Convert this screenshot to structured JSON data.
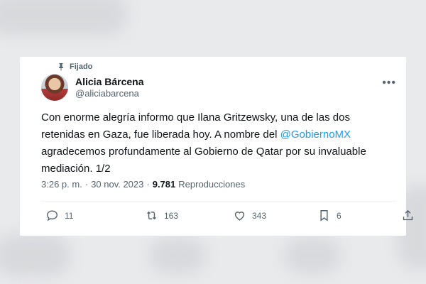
{
  "post": {
    "pinned_label": "Fijado",
    "author_name": "Alicia Bárcena",
    "author_handle": "@aliciabarcena",
    "more_label": "•••",
    "text_part1": "Con enorme alegría informo que Ilana Gritzewsky, una de las dos retenidas en Gaza, fue liberada hoy. A nombre del ",
    "mention": "@GobiernoMX",
    "text_part2": " agradecemos profundamente al Gobierno de Qatar por su invaluable mediación. 1/2",
    "time": "3:26 p. m.",
    "separator": "·",
    "date": "30 nov. 2023",
    "views_count": "9.781",
    "views_label": "Reproducciones"
  },
  "actions": {
    "replies": "11",
    "reposts": "163",
    "likes": "343",
    "bookmarks": "6"
  },
  "colors": {
    "accent": "#1d9bf0",
    "text": "#0f1419",
    "secondary": "#536471"
  },
  "icons": [
    "pin-icon",
    "more-icon",
    "reply-icon",
    "repost-icon",
    "like-icon",
    "bookmark-icon",
    "share-icon"
  ]
}
